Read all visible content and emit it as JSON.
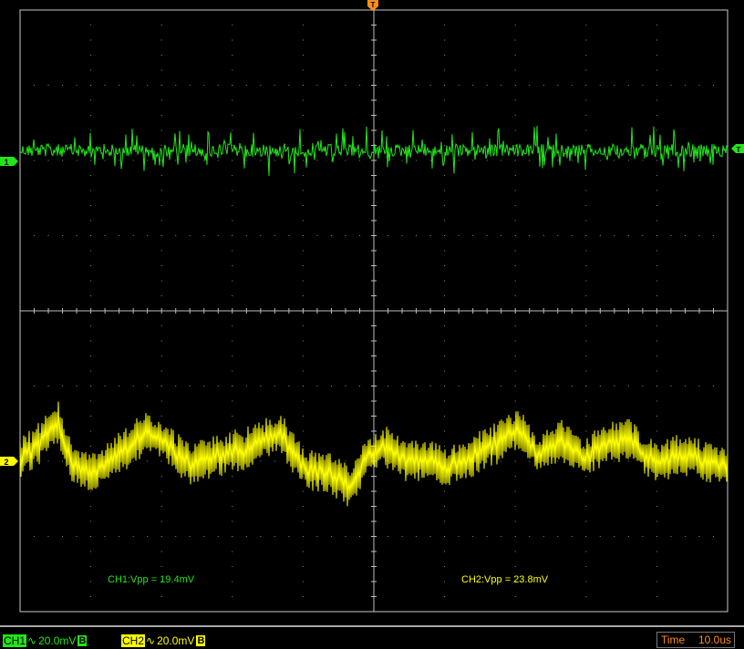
{
  "trigger_marker": "T",
  "ch1": {
    "marker": "1",
    "trigger_level_marker": "T",
    "color": "#22e61a",
    "name": "CH1",
    "coupling": "∿",
    "scale": "20.0mV",
    "bandwidth": "B",
    "measurement": "CH1:Vpp = 19.4mV"
  },
  "ch2": {
    "marker": "2",
    "color": "#ffff00",
    "name": "CH2",
    "coupling": "∿",
    "scale": "20.0mV",
    "bandwidth": "B",
    "measurement": "CH2:Vpp = 23.8mV"
  },
  "timebase": {
    "label": "Time",
    "value": "10.0us",
    "color": "#ff8c1a"
  }
}
